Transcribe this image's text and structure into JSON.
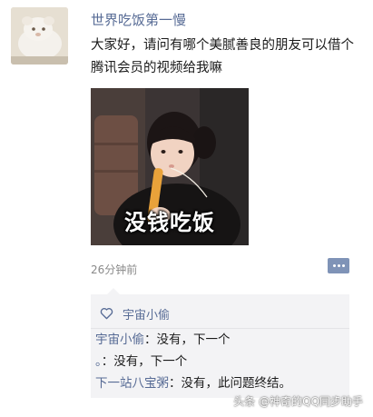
{
  "post": {
    "username": "世界吃饭第一慢",
    "text": "大家好，请问有哪个美腻善良的朋友可以借个腾讯会员的视频给我嘛",
    "image_caption": "没钱吃饭",
    "timestamp": "26分钟前"
  },
  "interactions": {
    "likes": [
      "宇宙小偷"
    ],
    "comments": [
      {
        "author": "宇宙小偷",
        "separator": "：",
        "text": "没有，下一个"
      },
      {
        "author": "。",
        "separator": "：",
        "text": "没有，下一个"
      },
      {
        "author": "下一站八宝粥",
        "separator": "：",
        "text": "没有，此问题终结。"
      }
    ]
  },
  "watermark": "头条 @神奇的QQ同步助手",
  "colors": {
    "link_blue": "#576b95",
    "comment_bg": "#f3f3f5",
    "comment_button": "#7f93b7"
  },
  "icons": {
    "like": "heart-outline-icon",
    "comment": "comment-dots-icon"
  }
}
